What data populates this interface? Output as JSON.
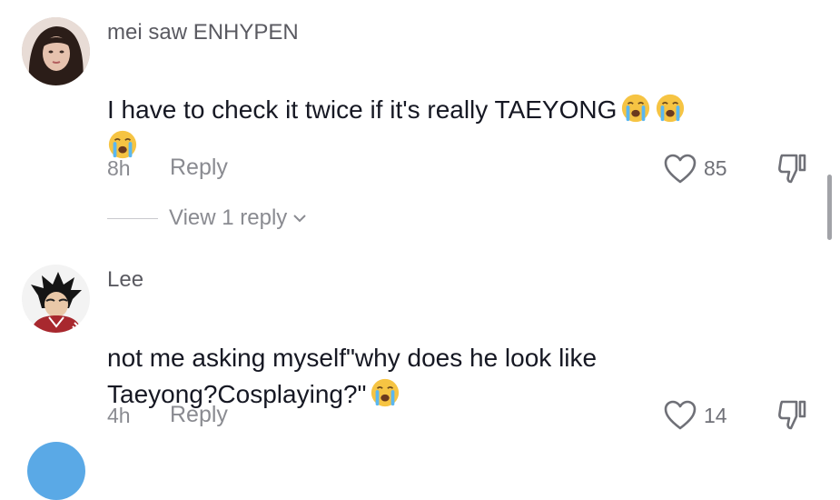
{
  "comments": [
    {
      "username": "mei saw ENHYPEN",
      "text": "I have to check it twice if it's really TAEYONG",
      "time": "8h",
      "reply_label": "Reply",
      "likes": "85",
      "view_replies": "View 1 reply",
      "emoji": "loudly-crying-face"
    },
    {
      "username": "Lee",
      "text_line1": "not me asking myself\"why does he look like",
      "text_line2": "Taeyong?Cosplaying?\"",
      "time": "4h",
      "reply_label": "Reply",
      "likes": "14",
      "emoji": "loudly-crying-face"
    }
  ],
  "colors": {
    "text": "#161823",
    "secondary": "#8a8b91",
    "emoji_face": "#f6c443"
  }
}
